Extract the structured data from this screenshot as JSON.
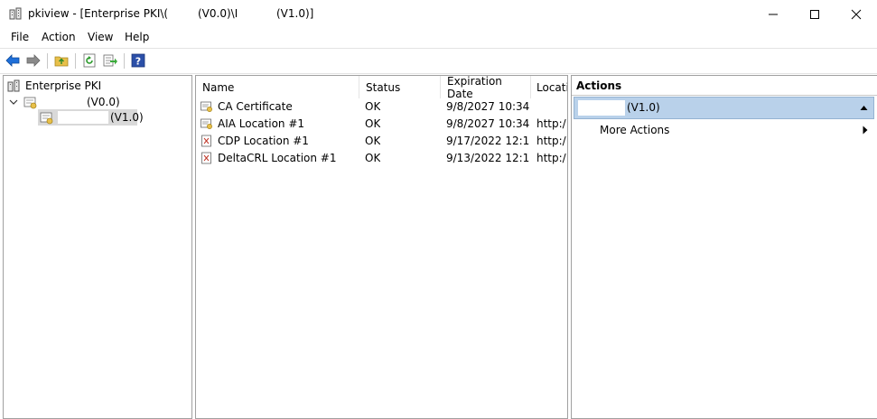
{
  "window": {
    "title_prefix": "pkiview - [Enterprise PKI\\(",
    "title_version_a": "(V0.0)\\I",
    "title_version_b": "(V1.0)]",
    "minimize_glyph": "—",
    "maximize_glyph": "☐",
    "close_glyph": "✕"
  },
  "menu": [
    "File",
    "Action",
    "View",
    "Help"
  ],
  "tree": {
    "root_label": "Enterprise PKI",
    "child_label": "(V0.0)",
    "grandchild_label": "(V1.0)"
  },
  "list": {
    "columns": [
      "Name",
      "Status",
      "Expiration Date",
      "Locati"
    ],
    "rows": [
      {
        "name": "CA Certificate",
        "status": "OK",
        "expiration": "9/8/2027 10:34 ...",
        "location": ""
      },
      {
        "name": "AIA Location #1",
        "status": "OK",
        "expiration": "9/8/2027 10:34 ...",
        "location": "http:/"
      },
      {
        "name": "CDP Location #1",
        "status": "OK",
        "expiration": "9/17/2022 12:1...",
        "location": "http:/"
      },
      {
        "name": "DeltaCRL Location #1",
        "status": "OK",
        "expiration": "9/13/2022 12:1...",
        "location": "http:/"
      }
    ]
  },
  "actions": {
    "title": "Actions",
    "section_label": "(V1.0)",
    "more_actions": "More Actions"
  },
  "colors": {
    "selection": "#b9d1ea",
    "back_arrow": "#1e6fd9",
    "help_icon": "#2b4fa8"
  }
}
